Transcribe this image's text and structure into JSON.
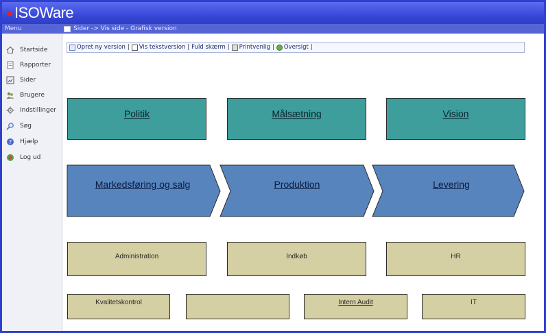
{
  "app": {
    "title": "ISOWare"
  },
  "menu_bar": {
    "label": "Menu",
    "breadcrumb": "Sider -> Vis side - Grafisk version"
  },
  "sidebar": {
    "items": [
      {
        "label": "Startside",
        "icon": "home-icon"
      },
      {
        "label": "Rapporter",
        "icon": "report-icon"
      },
      {
        "label": "Sider",
        "icon": "page-icon"
      },
      {
        "label": "Brugere",
        "icon": "users-icon"
      },
      {
        "label": "Indstillinger",
        "icon": "settings-icon"
      },
      {
        "label": "Søg",
        "icon": "search-icon"
      },
      {
        "label": "Hjælp",
        "icon": "help-icon"
      },
      {
        "label": "Log ud",
        "icon": "logout-icon"
      }
    ]
  },
  "toolbar": {
    "new_version": "Opret ny version",
    "text_version": "Vis tekstversion",
    "fullscreen": "Fuld skærm",
    "print": "Printvenlig",
    "overview": "Oversigt",
    "separator": "|"
  },
  "diagram": {
    "row1": [
      "Politik",
      "Målsætning",
      "Vision"
    ],
    "row2": [
      "Markedsføring og salg",
      "Produktion",
      "Levering"
    ],
    "row3": [
      "Administration",
      "Indkøb",
      "HR"
    ],
    "row4": [
      "Kvalitetskontrol",
      "",
      "Intern Audit",
      "IT"
    ]
  },
  "colors": {
    "window_border": "#2f3fd0",
    "teal_box": "#3d9e9b",
    "process_arrow": "#5784bd",
    "support_box": "#d5d0a3"
  }
}
